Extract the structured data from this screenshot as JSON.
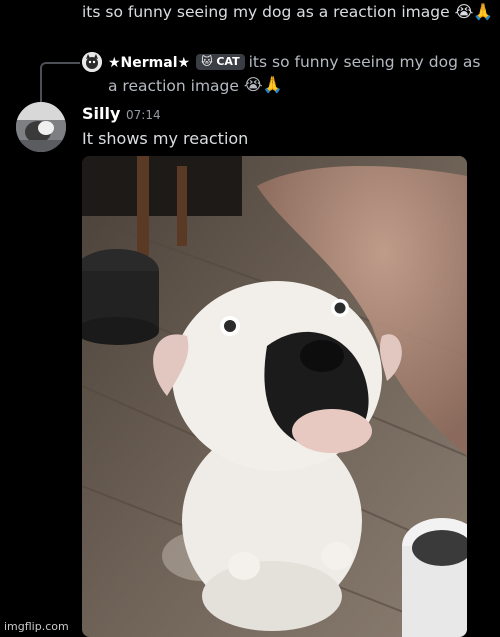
{
  "previous_message": {
    "text": "its so funny seeing my dog as a reaction image",
    "emoji": "😭🙏"
  },
  "reply": {
    "author": "★Nermal★",
    "tag": "🐱 CAT",
    "text": "its so funny seeing my dog as a reaction image",
    "emoji": "😭🙏"
  },
  "message": {
    "author": "Silly",
    "timestamp": "07:14",
    "text": "It shows my reaction"
  },
  "attachment": {
    "subject": "white dog with black nose patch looking up at camera"
  },
  "watermark": "imgflip.com",
  "colors": {
    "background": "#000000",
    "text": "#dbdee1",
    "muted": "#949ba4",
    "username": "#ffffff",
    "reply_spine": "#4e5058"
  }
}
